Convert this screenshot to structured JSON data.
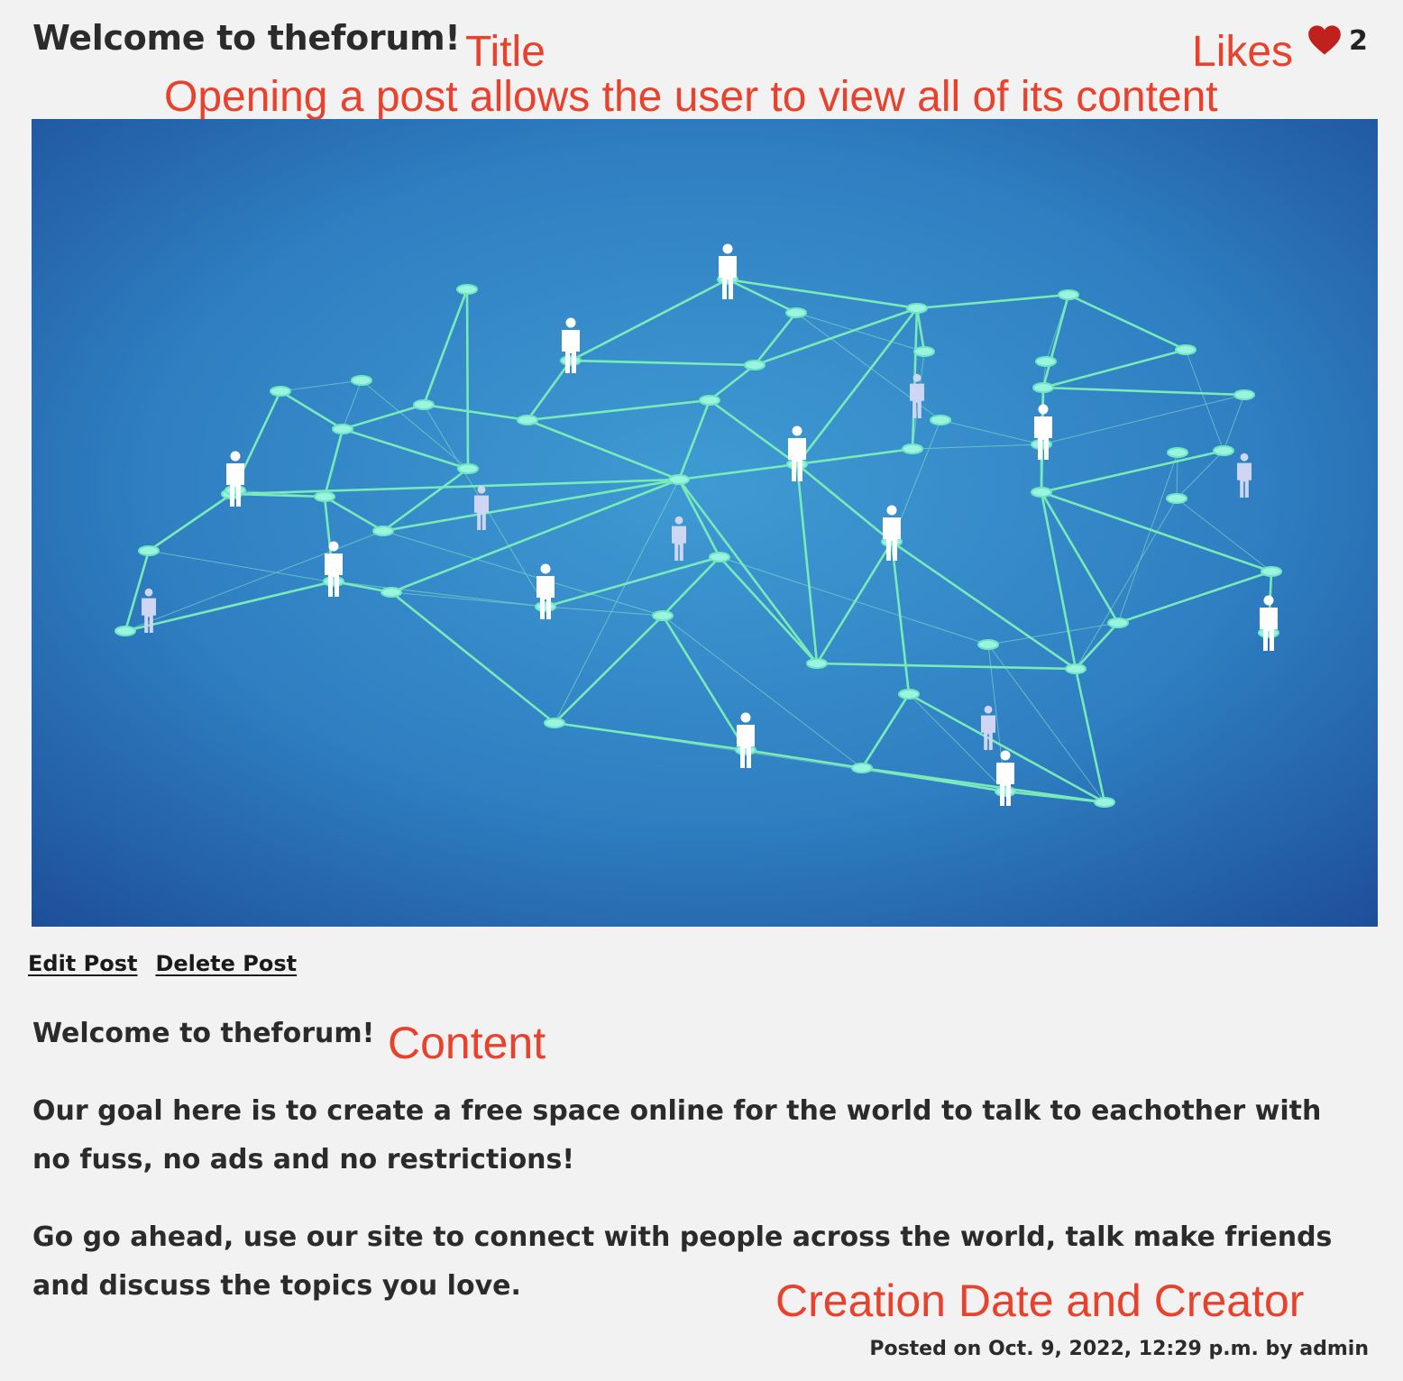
{
  "post": {
    "title": "Welcome to theforum!",
    "likes": "2",
    "actions": {
      "edit": "Edit Post",
      "delete": "Delete Post"
    },
    "content": {
      "greeting": "Welcome to theforum!",
      "paragraph1": "Our goal here is to create a free space online for the world to talk to eachother with no fuss, no ads and no restrictions!",
      "paragraph2": "Go go ahead, use our site to connect with people across the world, talk make friends and discuss the topics you love."
    },
    "footer": "Posted on Oct. 9, 2022, 12:29 p.m. by admin"
  },
  "annotations": {
    "title": "Title",
    "likes": "Likes",
    "open": "Opening a post allows the user to view all of its content",
    "content": "Content",
    "creation": "Creation Date and Creator"
  },
  "icons": {
    "like": "heart-icon"
  },
  "colors": {
    "annotation": "#e8412c",
    "heart": "#c0211c",
    "background": "#f2f2f2"
  }
}
